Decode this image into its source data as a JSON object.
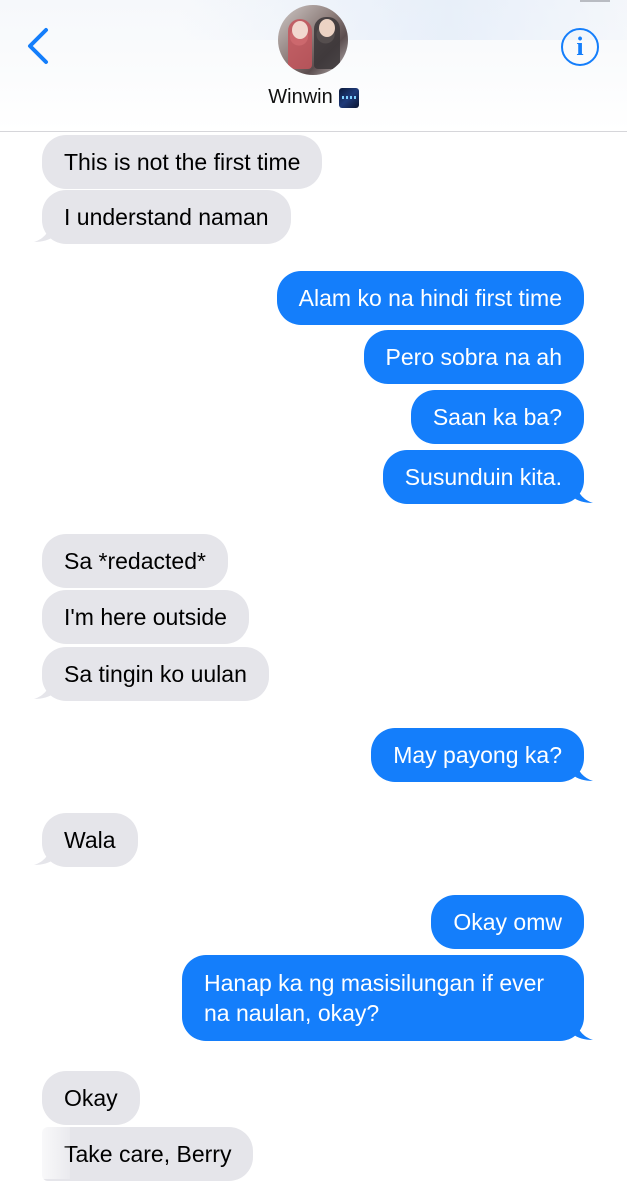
{
  "header": {
    "contact_name": "Winwin",
    "avatar_icon": "avatar-photo",
    "back_icon": "chevron-left-icon",
    "info_icon": "info-icon",
    "info_glyph": "i",
    "accent": "#147efb"
  },
  "messages": [
    {
      "dir": "in",
      "text": "This is not the first time"
    },
    {
      "dir": "in",
      "text": "I understand naman"
    },
    {
      "dir": "out",
      "text": "Alam ko na hindi first time"
    },
    {
      "dir": "out",
      "text": "Pero sobra na ah"
    },
    {
      "dir": "out",
      "text": "Saan ka ba?"
    },
    {
      "dir": "out",
      "text": "Susunduin kita."
    },
    {
      "dir": "in",
      "text": "Sa *redacted*"
    },
    {
      "dir": "in",
      "text": "I'm here outside"
    },
    {
      "dir": "in",
      "text": "Sa tingin ko uulan"
    },
    {
      "dir": "out",
      "text": "May payong ka?"
    },
    {
      "dir": "in",
      "text": "Wala"
    },
    {
      "dir": "out",
      "text": "Okay omw"
    },
    {
      "dir": "out",
      "text": "Hanap ka ng masisilungan if ever na naulan, okay?"
    },
    {
      "dir": "in",
      "text": "Okay"
    },
    {
      "dir": "in",
      "text": "Take care, Berry"
    }
  ],
  "colors": {
    "incoming_bubble": "#e5e5ea",
    "outgoing_bubble": "#147efb"
  }
}
